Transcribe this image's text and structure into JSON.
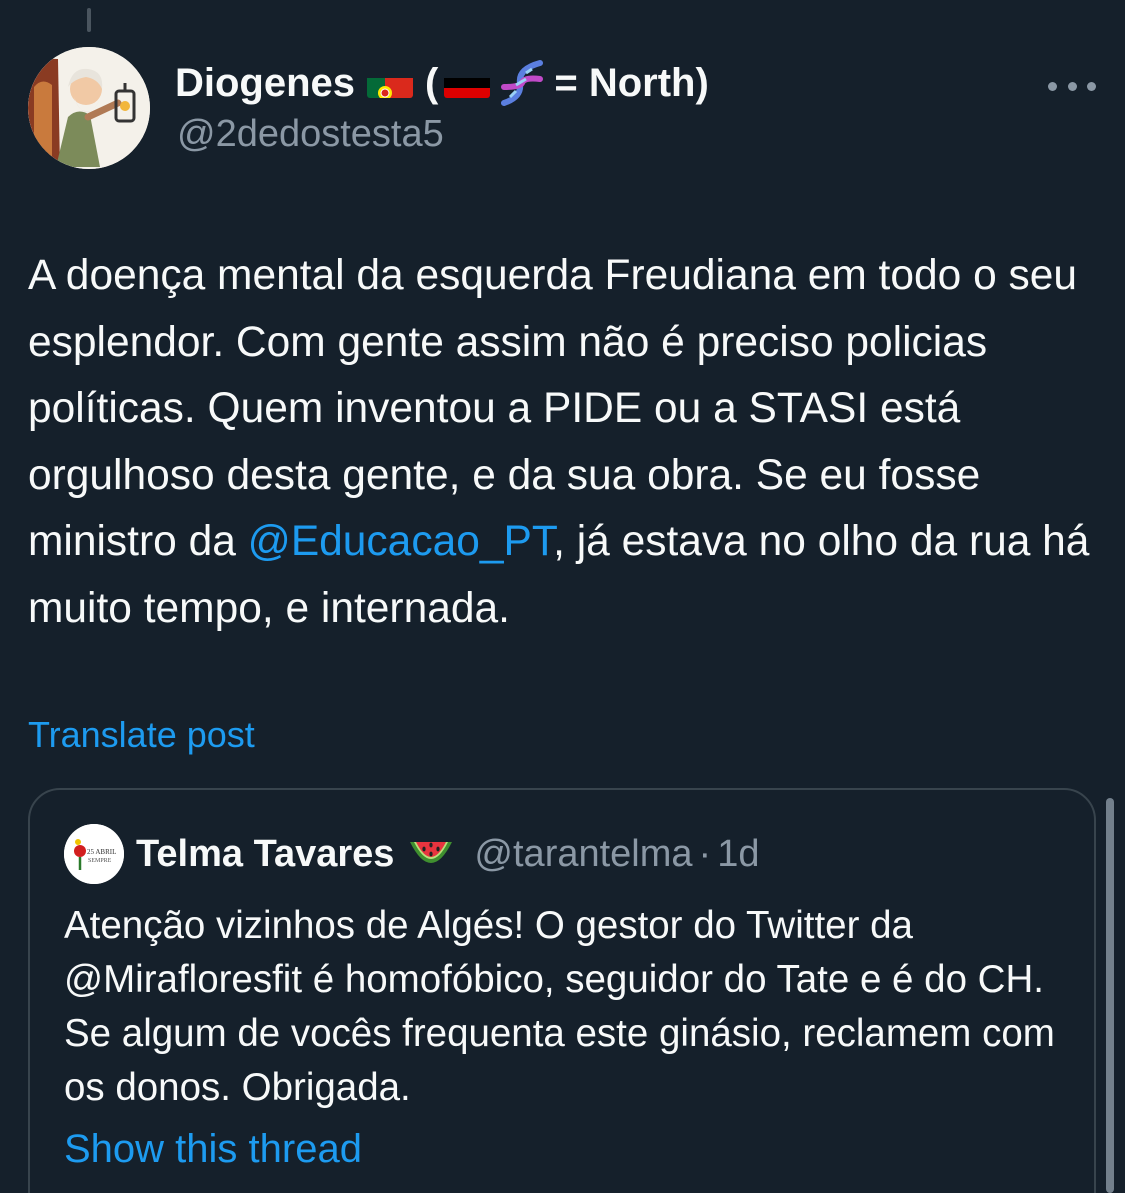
{
  "author": {
    "name": "Diogenes",
    "name_suffix_open": "(",
    "name_suffix_text": "= North)",
    "handle": "@2dedostesta5",
    "flag_icon": "portugal-flag-icon",
    "flag2_icon": "germany-flag-icon",
    "dna_icon": "dna-icon"
  },
  "tweet": {
    "text_before": "A doença mental da esquerda Freudiana em todo o seu esplendor. Com gente assim não é preciso policias políticas. Quem inventou a PIDE ou a STASI está orgulhoso desta gente, e da sua obra. Se eu fosse ministro da ",
    "mention": "@Educacao_PT",
    "text_after": ", já estava no olho da rua há muito tempo, e internada.",
    "translate_label": "Translate post"
  },
  "quote": {
    "name": "Telma Tavares",
    "name_emoji_icon": "watermelon-icon",
    "handle": "@tarantelma",
    "separator": "·",
    "time": "1d",
    "avatar_text_1": "25 ABRIL",
    "avatar_text_2": "SEMPRE",
    "text": "Atenção vizinhos de Algés! O gestor do Twitter da @Mirafloresfit é homofóbico, seguidor do Tate e é do CH. Se algum de vocês frequenta este ginásio, reclamem com os donos. Obrigada.",
    "show_thread_label": "Show this thread"
  },
  "colors": {
    "background": "#15202b",
    "text": "#f7f9f9",
    "secondary": "#8b98a5",
    "accent": "#1d9bf0",
    "border": "#38444d"
  }
}
